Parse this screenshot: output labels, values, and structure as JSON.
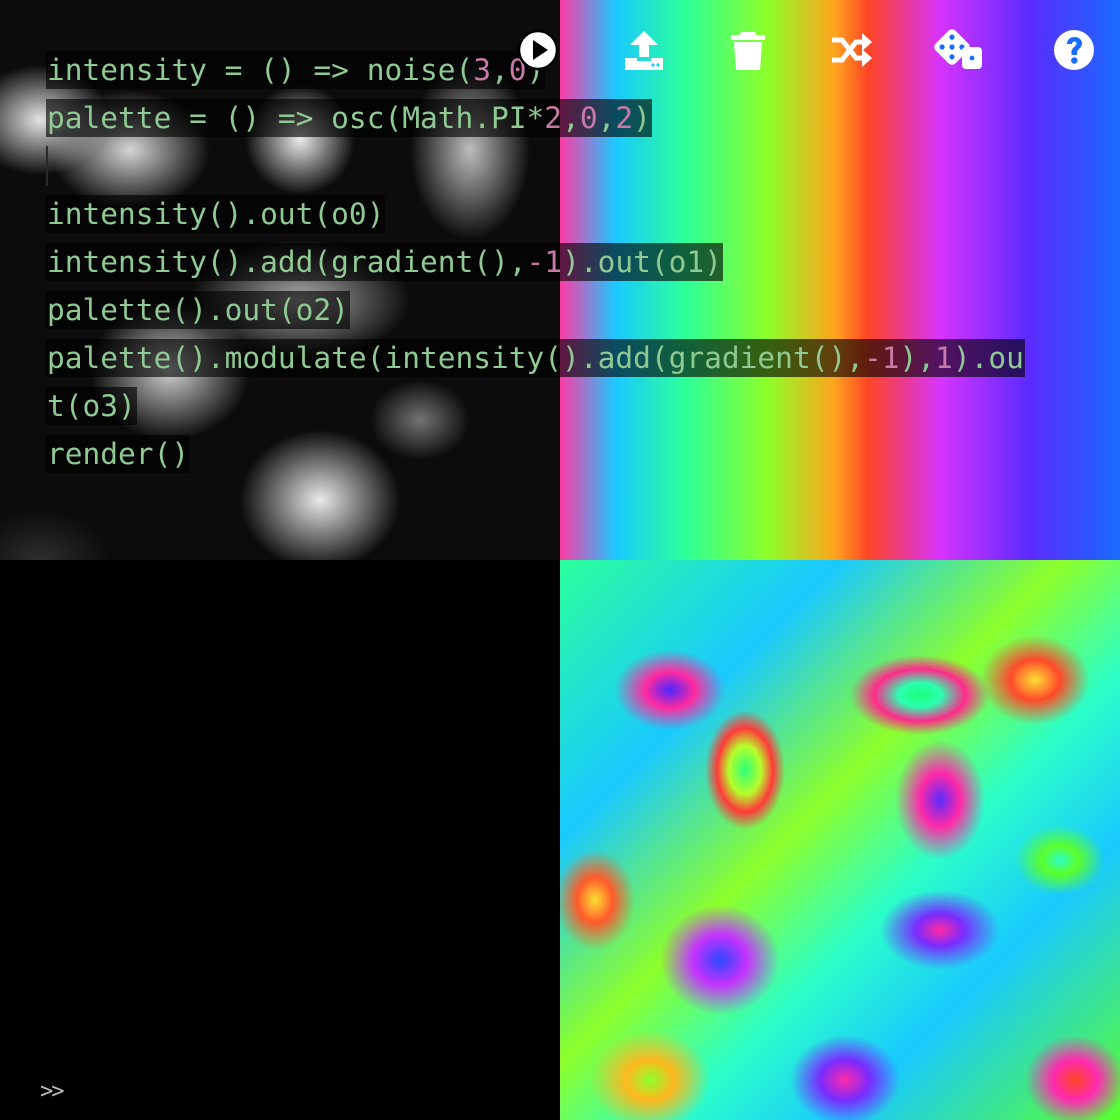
{
  "editor": {
    "lines": [
      "intensity = () => noise(3,0)",
      "palette = () => osc(Math.PI*2,0,2)",
      "",
      "intensity().out(o0)",
      "intensity().add(gradient(),-1).out(o1)",
      "palette().out(o2)",
      "palette().modulate(intensity().add(gradient(),-1),1).ou",
      "t(o3)",
      "render()"
    ]
  },
  "toolbar": {
    "buttons": [
      {
        "name": "run",
        "icon": "play-circle-icon"
      },
      {
        "name": "upload",
        "icon": "upload-icon"
      },
      {
        "name": "clear",
        "icon": "trash-icon"
      },
      {
        "name": "shuffle",
        "icon": "shuffle-icon"
      },
      {
        "name": "random",
        "icon": "dice-icon"
      },
      {
        "name": "help",
        "icon": "question-circle-icon"
      }
    ],
    "icon_color": "#ffffff"
  },
  "outputs": [
    "o0",
    "o1",
    "o2",
    "o3"
  ],
  "console": {
    "prompt": ">>"
  }
}
